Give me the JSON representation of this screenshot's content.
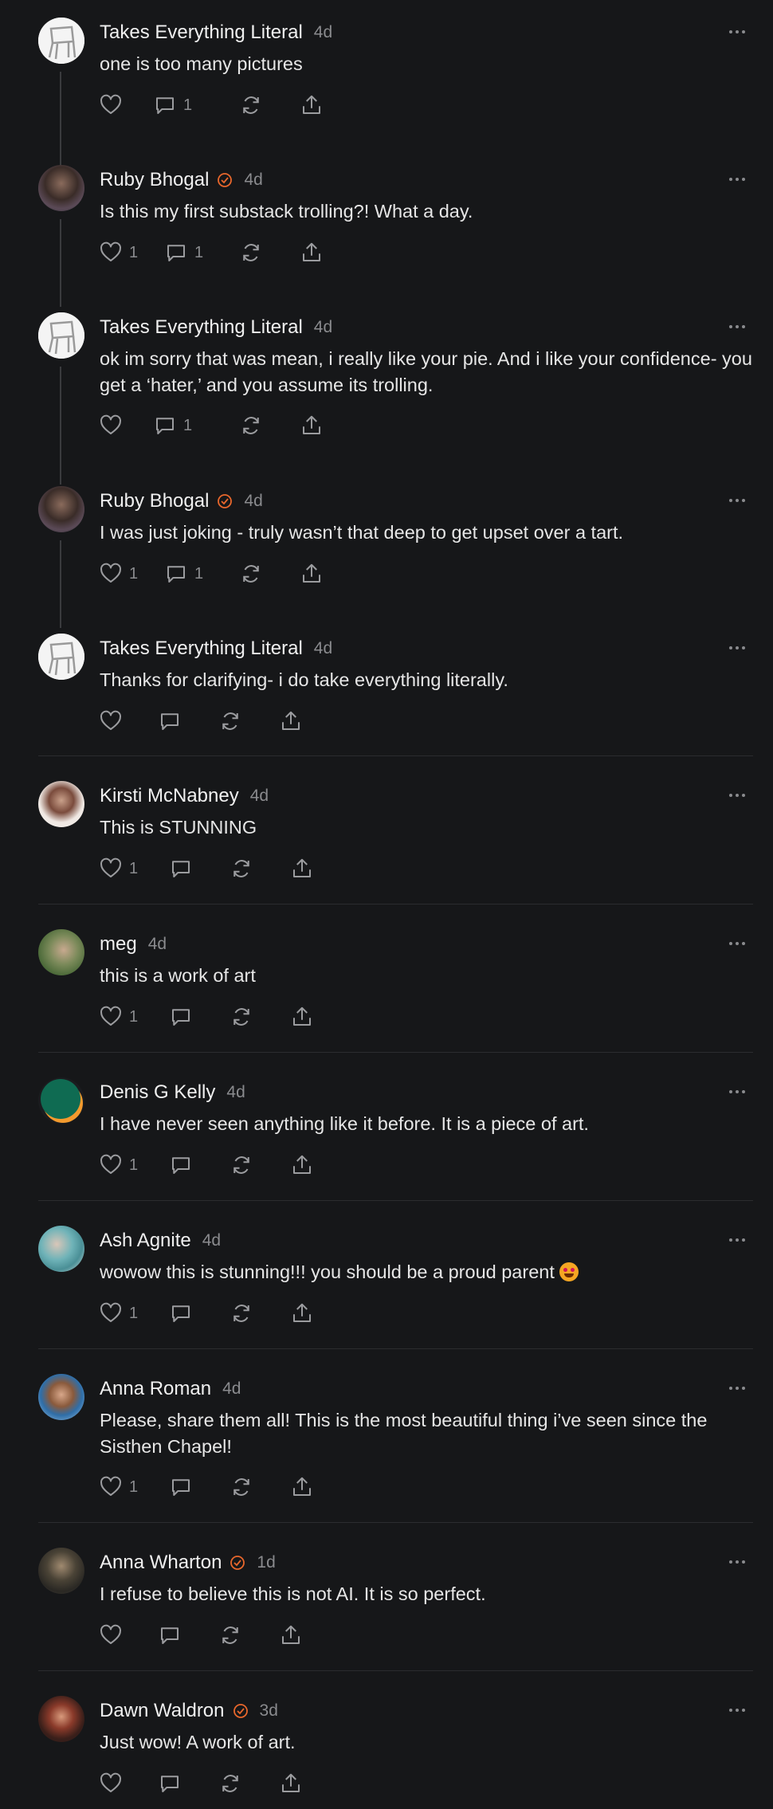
{
  "colors": {
    "background": "#161719",
    "verified": "#e8672c",
    "muted": "#8a8b8e",
    "divider": "#2b2c2f"
  },
  "comments": [
    {
      "author": "Takes Everything Literal",
      "verified": false,
      "time": "4d",
      "text": "one is too many pictures",
      "likes": "",
      "replies": "1",
      "avatar": "chair-avatar"
    },
    {
      "author": "Ruby Bhogal",
      "verified": true,
      "time": "4d",
      "text": "Is this my first substack trolling?! What a day.",
      "likes": "1",
      "replies": "1",
      "avatar": "photo-avatar"
    },
    {
      "author": "Takes Everything Literal",
      "verified": false,
      "time": "4d",
      "text": "ok im sorry that was mean, i really like your pie. And i like your confidence- you get a ‘hater,’ and you assume its trolling.",
      "likes": "",
      "replies": "1",
      "avatar": "chair-avatar"
    },
    {
      "author": "Ruby Bhogal",
      "verified": true,
      "time": "4d",
      "text": "I was just joking - truly wasn’t that deep to get upset over a tart.",
      "likes": "1",
      "replies": "1",
      "avatar": "photo-avatar"
    },
    {
      "author": "Takes Everything Literal",
      "verified": false,
      "time": "4d",
      "text": "Thanks for clarifying- i do take everything literally.",
      "likes": "",
      "replies": "",
      "avatar": "chair-avatar"
    },
    {
      "author": "Kirsti McNabney",
      "verified": false,
      "time": "4d",
      "text": "This is STUNNING",
      "likes": "1",
      "replies": "",
      "avatar": "photo-avatar"
    },
    {
      "author": "meg",
      "verified": false,
      "time": "4d",
      "text": "this is a work of art",
      "likes": "1",
      "replies": "",
      "avatar": "photo-avatar"
    },
    {
      "author": "Denis G Kelly",
      "verified": false,
      "time": "4d",
      "text": "I have never seen anything like it before. It is a piece of art.",
      "likes": "1",
      "replies": "",
      "avatar": "green-circle-avatar"
    },
    {
      "author": "Ash Agnite",
      "verified": false,
      "time": "4d",
      "text": "wowow this is stunning!!! you should be a proud parent",
      "emoji": "heart-eyes-emoji",
      "likes": "1",
      "replies": "",
      "avatar": "photo-avatar"
    },
    {
      "author": "Anna Roman",
      "verified": false,
      "time": "4d",
      "text": "Please, share them all! This is the most beautiful thing i’ve seen since the Sisthen Chapel!",
      "likes": "1",
      "replies": "",
      "avatar": "photo-avatar"
    },
    {
      "author": "Anna Wharton",
      "verified": true,
      "time": "1d",
      "text": "I refuse to believe this is not AI. It is so perfect.",
      "likes": "",
      "replies": "",
      "avatar": "photo-avatar"
    },
    {
      "author": "Dawn Waldron",
      "verified": true,
      "time": "3d",
      "text": "Just wow! A work of art.",
      "likes": "",
      "replies": "",
      "avatar": "photo-avatar"
    }
  ]
}
